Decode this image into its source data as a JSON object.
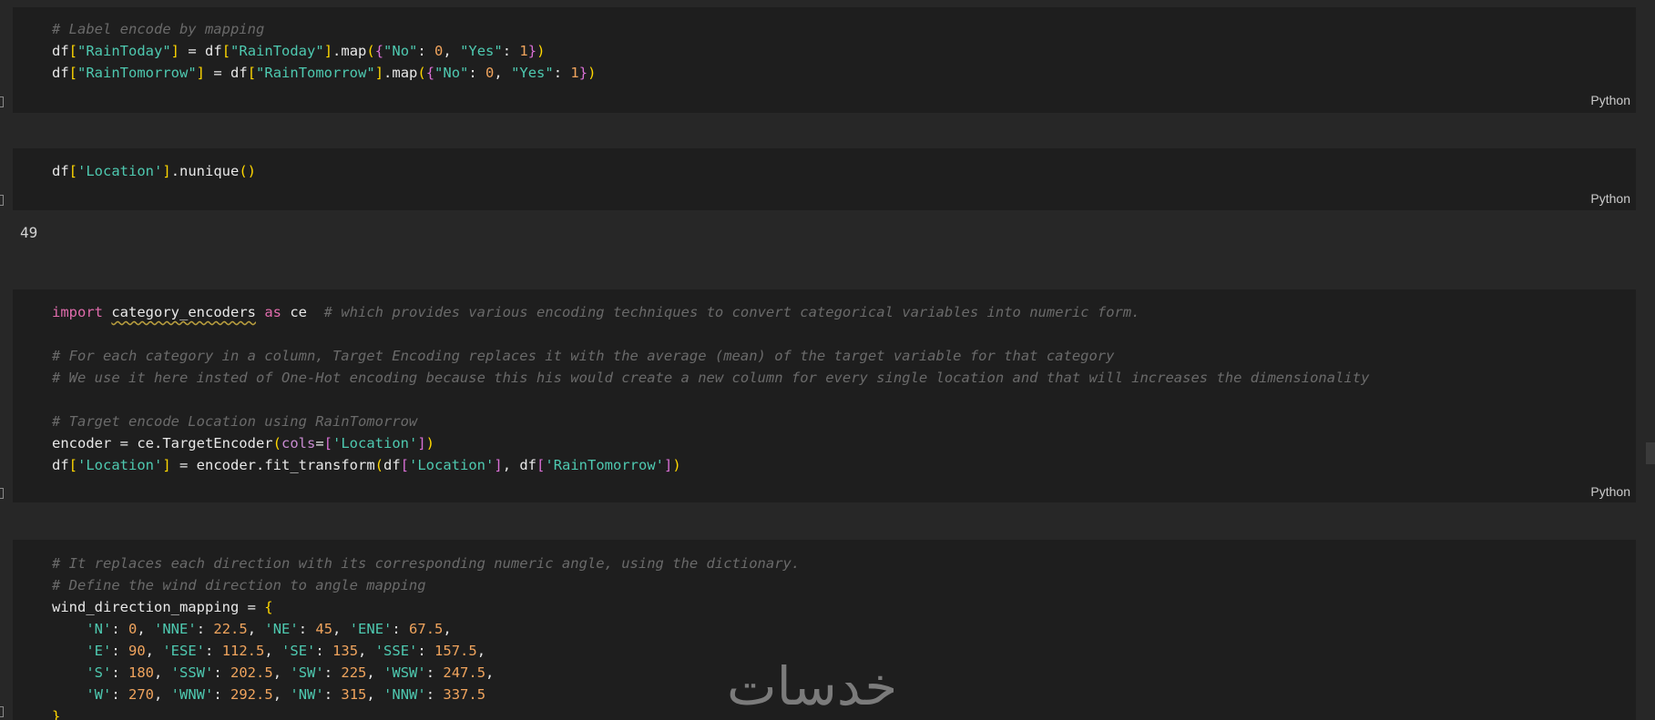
{
  "cells": [
    {
      "language": "Python",
      "lines": [
        [
          {
            "t": "# Label encode by mapping",
            "c": "c"
          }
        ],
        [
          {
            "t": "df",
            "c": "v"
          },
          {
            "t": "[",
            "c": "p1"
          },
          {
            "t": "\"RainToday\"",
            "c": "s"
          },
          {
            "t": "]",
            "c": "p1"
          },
          {
            "t": " = ",
            "c": "v"
          },
          {
            "t": "df",
            "c": "v"
          },
          {
            "t": "[",
            "c": "p1"
          },
          {
            "t": "\"RainToday\"",
            "c": "s"
          },
          {
            "t": "]",
            "c": "p1"
          },
          {
            "t": ".map",
            "c": "v"
          },
          {
            "t": "(",
            "c": "p1"
          },
          {
            "t": "{",
            "c": "p2"
          },
          {
            "t": "\"No\"",
            "c": "s"
          },
          {
            "t": ": ",
            "c": "v"
          },
          {
            "t": "0",
            "c": "n"
          },
          {
            "t": ", ",
            "c": "v"
          },
          {
            "t": "\"Yes\"",
            "c": "s"
          },
          {
            "t": ": ",
            "c": "v"
          },
          {
            "t": "1",
            "c": "n"
          },
          {
            "t": "}",
            "c": "p2"
          },
          {
            "t": ")",
            "c": "p1"
          }
        ],
        [
          {
            "t": "df",
            "c": "v"
          },
          {
            "t": "[",
            "c": "p1"
          },
          {
            "t": "\"RainTomorrow\"",
            "c": "s"
          },
          {
            "t": "]",
            "c": "p1"
          },
          {
            "t": " = ",
            "c": "v"
          },
          {
            "t": "df",
            "c": "v"
          },
          {
            "t": "[",
            "c": "p1"
          },
          {
            "t": "\"RainTomorrow\"",
            "c": "s"
          },
          {
            "t": "]",
            "c": "p1"
          },
          {
            "t": ".map",
            "c": "v"
          },
          {
            "t": "(",
            "c": "p1"
          },
          {
            "t": "{",
            "c": "p2"
          },
          {
            "t": "\"No\"",
            "c": "s"
          },
          {
            "t": ": ",
            "c": "v"
          },
          {
            "t": "0",
            "c": "n"
          },
          {
            "t": ", ",
            "c": "v"
          },
          {
            "t": "\"Yes\"",
            "c": "s"
          },
          {
            "t": ": ",
            "c": "v"
          },
          {
            "t": "1",
            "c": "n"
          },
          {
            "t": "}",
            "c": "p2"
          },
          {
            "t": ")",
            "c": "p1"
          }
        ]
      ]
    },
    {
      "language": "Python",
      "lines": [
        [
          {
            "t": "df",
            "c": "v"
          },
          {
            "t": "[",
            "c": "p1"
          },
          {
            "t": "'Location'",
            "c": "s"
          },
          {
            "t": "]",
            "c": "p1"
          },
          {
            "t": ".nunique",
            "c": "v"
          },
          {
            "t": "()",
            "c": "p1"
          }
        ]
      ],
      "output": "49"
    },
    {
      "language": "Python",
      "lines": [
        [
          {
            "t": "import",
            "c": "k"
          },
          {
            "t": " ",
            "c": "v"
          },
          {
            "t": "category_encoders",
            "c": "v sq"
          },
          {
            "t": " ",
            "c": "v"
          },
          {
            "t": "as",
            "c": "k"
          },
          {
            "t": " ce  ",
            "c": "v"
          },
          {
            "t": "# which provides various encoding techniques to convert categorical variables into numeric form.",
            "c": "c"
          }
        ],
        [],
        [
          {
            "t": "# For each category in a column, Target Encoding replaces it with the average (mean) of the target variable for that category",
            "c": "c"
          }
        ],
        [
          {
            "t": "# We use it here insted of One-Hot encoding because this his would create a new column for every single location and that will increases the dimensionality",
            "c": "c"
          }
        ],
        [],
        [
          {
            "t": "# Target encode Location using RainTomorrow",
            "c": "c"
          }
        ],
        [
          {
            "t": "encoder = ce.TargetEncoder",
            "c": "v"
          },
          {
            "t": "(",
            "c": "p1"
          },
          {
            "t": "cols",
            "c": "pm"
          },
          {
            "t": "=",
            "c": "v"
          },
          {
            "t": "[",
            "c": "p2"
          },
          {
            "t": "'Location'",
            "c": "s"
          },
          {
            "t": "]",
            "c": "p2"
          },
          {
            "t": ")",
            "c": "p1"
          }
        ],
        [
          {
            "t": "df",
            "c": "v"
          },
          {
            "t": "[",
            "c": "p1"
          },
          {
            "t": "'Location'",
            "c": "s"
          },
          {
            "t": "]",
            "c": "p1"
          },
          {
            "t": " = encoder.fit_transform",
            "c": "v"
          },
          {
            "t": "(",
            "c": "p1"
          },
          {
            "t": "df",
            "c": "v"
          },
          {
            "t": "[",
            "c": "p2"
          },
          {
            "t": "'Location'",
            "c": "s"
          },
          {
            "t": "]",
            "c": "p2"
          },
          {
            "t": ", df",
            "c": "v"
          },
          {
            "t": "[",
            "c": "p2"
          },
          {
            "t": "'RainTomorrow'",
            "c": "s"
          },
          {
            "t": "]",
            "c": "p2"
          },
          {
            "t": ")",
            "c": "p1"
          }
        ]
      ]
    },
    {
      "language": "",
      "lines": [
        [
          {
            "t": "# It replaces each direction with its corresponding numeric angle, using the dictionary.",
            "c": "c"
          }
        ],
        [
          {
            "t": "# Define the wind direction to angle mapping",
            "c": "c"
          }
        ],
        [
          {
            "t": "wind_direction_mapping = ",
            "c": "v"
          },
          {
            "t": "{",
            "c": "p1"
          }
        ],
        [
          {
            "t": "    ",
            "c": "v"
          },
          {
            "t": "'N'",
            "c": "s"
          },
          {
            "t": ": ",
            "c": "v"
          },
          {
            "t": "0",
            "c": "n"
          },
          {
            "t": ", ",
            "c": "v"
          },
          {
            "t": "'NNE'",
            "c": "s"
          },
          {
            "t": ": ",
            "c": "v"
          },
          {
            "t": "22.5",
            "c": "n"
          },
          {
            "t": ", ",
            "c": "v"
          },
          {
            "t": "'NE'",
            "c": "s"
          },
          {
            "t": ": ",
            "c": "v"
          },
          {
            "t": "45",
            "c": "n"
          },
          {
            "t": ", ",
            "c": "v"
          },
          {
            "t": "'ENE'",
            "c": "s"
          },
          {
            "t": ": ",
            "c": "v"
          },
          {
            "t": "67.5",
            "c": "n"
          },
          {
            "t": ",",
            "c": "v"
          }
        ],
        [
          {
            "t": "    ",
            "c": "v"
          },
          {
            "t": "'E'",
            "c": "s"
          },
          {
            "t": ": ",
            "c": "v"
          },
          {
            "t": "90",
            "c": "n"
          },
          {
            "t": ", ",
            "c": "v"
          },
          {
            "t": "'ESE'",
            "c": "s"
          },
          {
            "t": ": ",
            "c": "v"
          },
          {
            "t": "112.5",
            "c": "n"
          },
          {
            "t": ", ",
            "c": "v"
          },
          {
            "t": "'SE'",
            "c": "s"
          },
          {
            "t": ": ",
            "c": "v"
          },
          {
            "t": "135",
            "c": "n"
          },
          {
            "t": ", ",
            "c": "v"
          },
          {
            "t": "'SSE'",
            "c": "s"
          },
          {
            "t": ": ",
            "c": "v"
          },
          {
            "t": "157.5",
            "c": "n"
          },
          {
            "t": ",",
            "c": "v"
          }
        ],
        [
          {
            "t": "    ",
            "c": "v"
          },
          {
            "t": "'S'",
            "c": "s"
          },
          {
            "t": ": ",
            "c": "v"
          },
          {
            "t": "180",
            "c": "n"
          },
          {
            "t": ", ",
            "c": "v"
          },
          {
            "t": "'SSW'",
            "c": "s"
          },
          {
            "t": ": ",
            "c": "v"
          },
          {
            "t": "202.5",
            "c": "n"
          },
          {
            "t": ", ",
            "c": "v"
          },
          {
            "t": "'SW'",
            "c": "s"
          },
          {
            "t": ": ",
            "c": "v"
          },
          {
            "t": "225",
            "c": "n"
          },
          {
            "t": ", ",
            "c": "v"
          },
          {
            "t": "'WSW'",
            "c": "s"
          },
          {
            "t": ": ",
            "c": "v"
          },
          {
            "t": "247.5",
            "c": "n"
          },
          {
            "t": ",",
            "c": "v"
          }
        ],
        [
          {
            "t": "    ",
            "c": "v"
          },
          {
            "t": "'W'",
            "c": "s"
          },
          {
            "t": ": ",
            "c": "v"
          },
          {
            "t": "270",
            "c": "n"
          },
          {
            "t": ", ",
            "c": "v"
          },
          {
            "t": "'WNW'",
            "c": "s"
          },
          {
            "t": ": ",
            "c": "v"
          },
          {
            "t": "292.5",
            "c": "n"
          },
          {
            "t": ", ",
            "c": "v"
          },
          {
            "t": "'NW'",
            "c": "s"
          },
          {
            "t": ": ",
            "c": "v"
          },
          {
            "t": "315",
            "c": "n"
          },
          {
            "t": ", ",
            "c": "v"
          },
          {
            "t": "'NNW'",
            "c": "s"
          },
          {
            "t": ": ",
            "c": "v"
          },
          {
            "t": "337.5",
            "c": "n"
          }
        ],
        [
          {
            "t": "}",
            "c": "p1"
          }
        ]
      ]
    }
  ],
  "watermark": "خدسات"
}
